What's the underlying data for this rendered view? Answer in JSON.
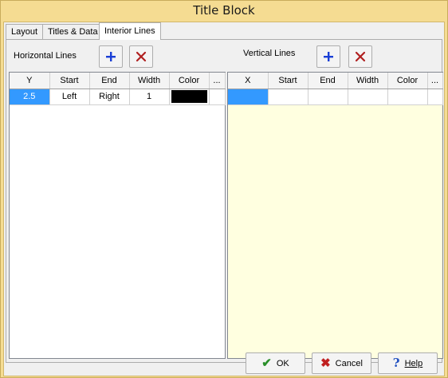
{
  "window": {
    "title": "Title Block"
  },
  "tabs": [
    {
      "label": "Layout"
    },
    {
      "label": "Titles & Data"
    },
    {
      "label": "Interior Lines"
    }
  ],
  "horizontal": {
    "label": "Horizontal Lines",
    "add_icon": "plus-icon",
    "delete_icon": "x-delete-icon",
    "columns": [
      "Y",
      "Start",
      "End",
      "Width",
      "Color",
      "..."
    ],
    "rows": [
      {
        "y": "2.5",
        "start": "Left",
        "end": "Right",
        "width": "1",
        "color": "#000000"
      }
    ]
  },
  "vertical": {
    "label": "Vertical Lines",
    "add_icon": "plus-icon",
    "delete_icon": "x-delete-icon",
    "columns": [
      "X",
      "Start",
      "End",
      "Width",
      "Color",
      "..."
    ]
  },
  "buttons": {
    "ok": "OK",
    "cancel": "Cancel",
    "help": "Help"
  },
  "colors": {
    "frame": "#f5dc92",
    "selection": "#3399ff",
    "vertical_grid_bg": "#ffffe0",
    "add_icon": "#1a3fd6",
    "delete_icon": "#b02020"
  }
}
